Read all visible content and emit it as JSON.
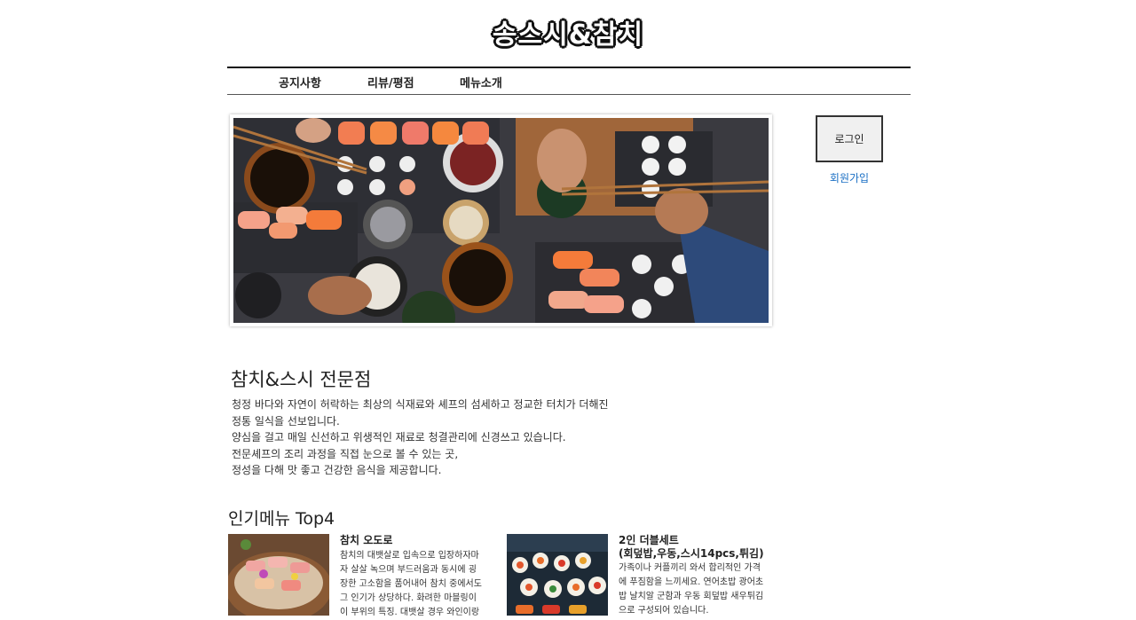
{
  "site": {
    "title": "송스시&참치"
  },
  "nav": {
    "items": [
      "공지사항",
      "리뷰/평점",
      "메뉴소개"
    ]
  },
  "auth": {
    "login_label": "로그인",
    "signup_label": "회원가입"
  },
  "intro": {
    "heading": "참치&스시 전문점",
    "lines": [
      "청정 바다와 자연이 허락하는 최상의 식재료와 셰프의 섬세하고 정교한 터치가 더해진",
      "정통 일식을 선보입니다.",
      "양심을 걸고 매일 신선하고 위생적인 재료로 청결관리에 신경쓰고 있습니다.",
      "전문셰프의 조리 과정을 직접 눈으로 볼 수 있는 곳,",
      "정성을 다해 맛 좋고 건강한 음식을 제공합니다."
    ]
  },
  "popular": {
    "heading": "인기메뉴 Top4",
    "items": [
      {
        "name_lines": [
          "참치 오도로"
        ],
        "desc_lines": [
          "참치의 대뱃살로 입속으로 입장하자마",
          "자 살살 녹으며 부드러움과 동시에 굉",
          "장한 고소함을 품어내어 참치 중에서도",
          "그 인기가 상당하다. 화려한 마블링이",
          "이 부위의 특징. 대뱃살 경우 와인이랑"
        ]
      },
      {
        "name_lines": [
          "2인 더블세트",
          "(회덮밥,우동,스시14pcs,튀김)"
        ],
        "desc_lines": [
          "가족이나 커플끼리 와서 합리적인 가격",
          "에 푸짐함을 느끼세요. 연어초밥 광어초",
          "밥 날치알 군함과 우동 회덮밥 새우튀김",
          "으로 구성되어 있습니다."
        ]
      }
    ]
  },
  "colors": {
    "link": "#1a6fc4",
    "accent": "#111111"
  }
}
